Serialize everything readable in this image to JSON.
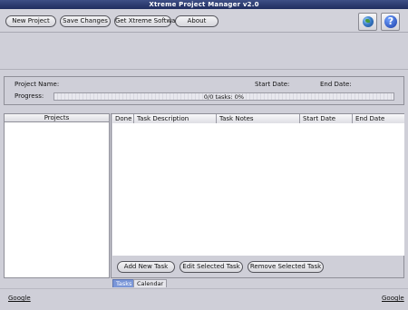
{
  "window": {
    "title": "Xtreme Project Manager v2.0"
  },
  "toolbar": {
    "new_project": "New Project",
    "save_changes": "Save Changes",
    "get_software": "Get Xtreme Software",
    "about": "About",
    "globe_icon": "globe-icon",
    "help_icon": "help-icon",
    "help_glyph": "?"
  },
  "project": {
    "name_label": "Project Name:",
    "name_value": "",
    "start_label": "Start Date:",
    "start_value": "",
    "end_label": "End Date:",
    "end_value": "",
    "progress_label": "Progress:",
    "progress_text": "0/0 tasks: 0%",
    "progress_percent": 0
  },
  "projects_panel": {
    "header": "Projects",
    "items": []
  },
  "tasks_table": {
    "columns": [
      "Done",
      "Task Description",
      "Task Notes",
      "Start Date",
      "End Date"
    ],
    "rows": []
  },
  "task_buttons": {
    "add": "Add New Task",
    "edit": "Edit Selected Task",
    "remove": "Remove Selected Task"
  },
  "tabs": [
    {
      "label": "Tasks",
      "active": true
    },
    {
      "label": "Calendar",
      "active": false
    }
  ],
  "status": {
    "left_link": "Google",
    "right_link": "Google"
  },
  "colors": {
    "titlebar": "#2a3a72",
    "progress_fill": "#4a68c8",
    "active_tab": "#7a96d8"
  }
}
